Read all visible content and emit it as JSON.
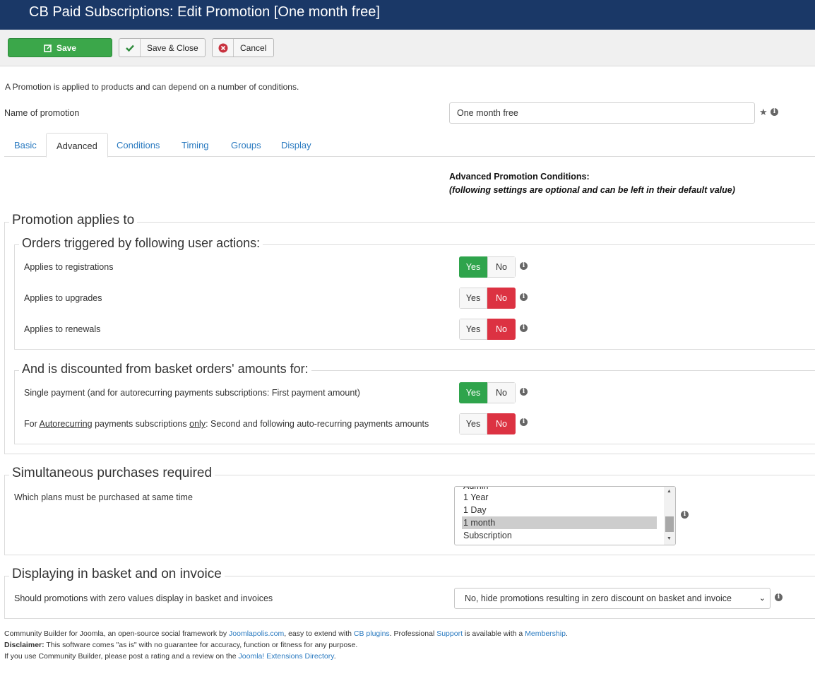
{
  "header": {
    "title": "CB Paid Subscriptions: Edit Promotion [One month free]"
  },
  "toolbar": {
    "save_label": "Save",
    "save_close_label": "Save & Close",
    "cancel_label": "Cancel"
  },
  "form": {
    "intro": "A Promotion is applied to products and can depend on a number of conditions.",
    "name_label": "Name of promotion",
    "name_value": "One month free"
  },
  "tabs": [
    "Basic",
    "Advanced",
    "Conditions",
    "Timing",
    "Groups",
    "Display"
  ],
  "active_tab": "Advanced",
  "advanced": {
    "heading": "Advanced Promotion Conditions:",
    "subheading": "(following settings are optional and can be left in their default value)"
  },
  "applies": {
    "legend": "Promotion applies to",
    "orders": {
      "legend": "Orders triggered by following user actions:",
      "rows": [
        {
          "label": "Applies to registrations",
          "value": "Yes"
        },
        {
          "label": "Applies to upgrades",
          "value": "No"
        },
        {
          "label": "Applies to renewals",
          "value": "No"
        }
      ]
    },
    "discount": {
      "legend": "And is discounted from basket orders' amounts for:",
      "single_label": "Single payment (and for autorecurring payments subscriptions: First payment amount)",
      "single_value": "Yes",
      "recurring_label_1": "For ",
      "recurring_label_2": "Autorecurring",
      "recurring_label_3": " payments subscriptions ",
      "recurring_label_4": "only",
      "recurring_label_5": ": Second and following auto-recurring payments amounts",
      "recurring_value": "No"
    },
    "toggle_yes": "Yes",
    "toggle_no": "No"
  },
  "simultaneous": {
    "legend": "Simultaneous purchases required",
    "label": "Which plans must be purchased at same time",
    "options": [
      "Admin",
      "1 Year",
      "1 Day",
      "1 month",
      "Subscription"
    ],
    "selected": "1 month"
  },
  "displaying": {
    "legend": "Displaying in basket and on invoice",
    "label": "Should promotions with zero values display in basket and invoices",
    "select_value": "No, hide promotions resulting in zero discount on basket and invoice"
  },
  "footer": {
    "l1_a": "Community Builder for Joomla, an open-source social framework by ",
    "l1_link1": "Joomlapolis.com",
    "l1_b": ", easy to extend with ",
    "l1_link2": "CB plugins",
    "l1_c": ". Professional ",
    "l1_link3": "Support",
    "l1_d": " is available with a ",
    "l1_link4": "Membership",
    "l1_e": ".",
    "l2_bold": "Disclaimer:",
    "l2_text": " This software comes \"as is\" with no guarantee for accuracy, function or fitness for any purpose.",
    "l3_a": "If you use Community Builder, please post a rating and a review on the ",
    "l3_link": "Joomla! Extensions Directory",
    "l3_b": "."
  },
  "colors": {
    "header_bg": "#1a3867",
    "save_green": "#3ba74a",
    "yes_green": "#2fa44c",
    "no_red": "#dc3242",
    "link_blue": "#2a7ac0"
  }
}
